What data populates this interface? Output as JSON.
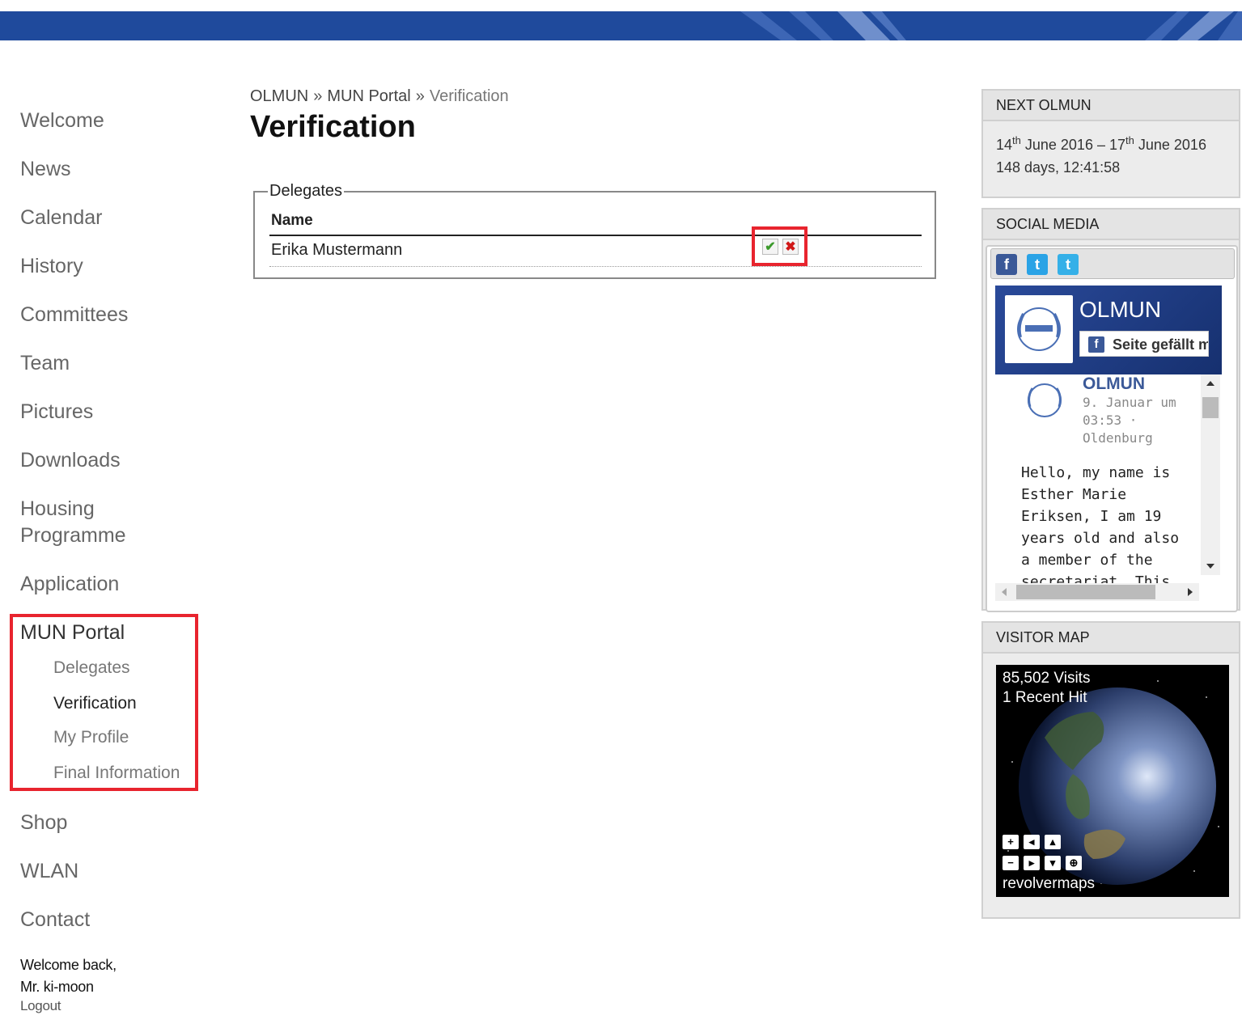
{
  "nav": {
    "items": [
      "Welcome",
      "News",
      "Calendar",
      "History",
      "Committees",
      "Team",
      "Pictures",
      "Downloads"
    ],
    "housing": [
      "Housing",
      "Programme"
    ],
    "application": "Application",
    "portal": "MUN Portal",
    "portal_sub": [
      "Delegates",
      "Verification",
      "My Profile",
      "Final Information"
    ],
    "items_after": [
      "Shop",
      "WLAN",
      "Contact"
    ],
    "welcome_line1": "Welcome back,",
    "welcome_line2": "Mr. ki-moon",
    "logout": "Logout"
  },
  "breadcrumb": {
    "root": "OLMUN",
    "sep": "»",
    "parent": "MUN Portal",
    "current": "Verification"
  },
  "page_title": "Verification",
  "delegates": {
    "legend": "Delegates",
    "column_header": "Name",
    "rows": [
      {
        "name": "Erika Mustermann",
        "accept_icon": "check-icon",
        "reject_icon": "x-icon"
      }
    ]
  },
  "next_olmun": {
    "title": "NEXT OLMUN",
    "start_day": "14",
    "start_sup": "th",
    "start_rest": " June 2016",
    "dash": "–",
    "end_day": "17",
    "end_sup": "th",
    "end_rest": " June 2016",
    "countdown": "148 days, 12:41:58"
  },
  "social": {
    "title": "SOCIAL MEDIA",
    "tabs": [
      "f",
      "t",
      "t"
    ],
    "page_name": "OLMUN",
    "like": "Seite gefällt mir",
    "post_author": "OLMUN",
    "post_meta": "9. Januar um 03:53 · Oldenburg",
    "post_text": "Hello, my name is Esther Marie Eriksen, I am 19 years old and also a member of the secretariat. This year I will be",
    "brand_color": "#3b5998"
  },
  "visitor_map": {
    "title": "VISITOR MAP",
    "visits": "85,502 Visits",
    "recent": "1 Recent Hit",
    "brand": "revolvermaps"
  },
  "colors": {
    "header_blue": "#1f4a9c",
    "highlight_red": "#e8242e"
  }
}
